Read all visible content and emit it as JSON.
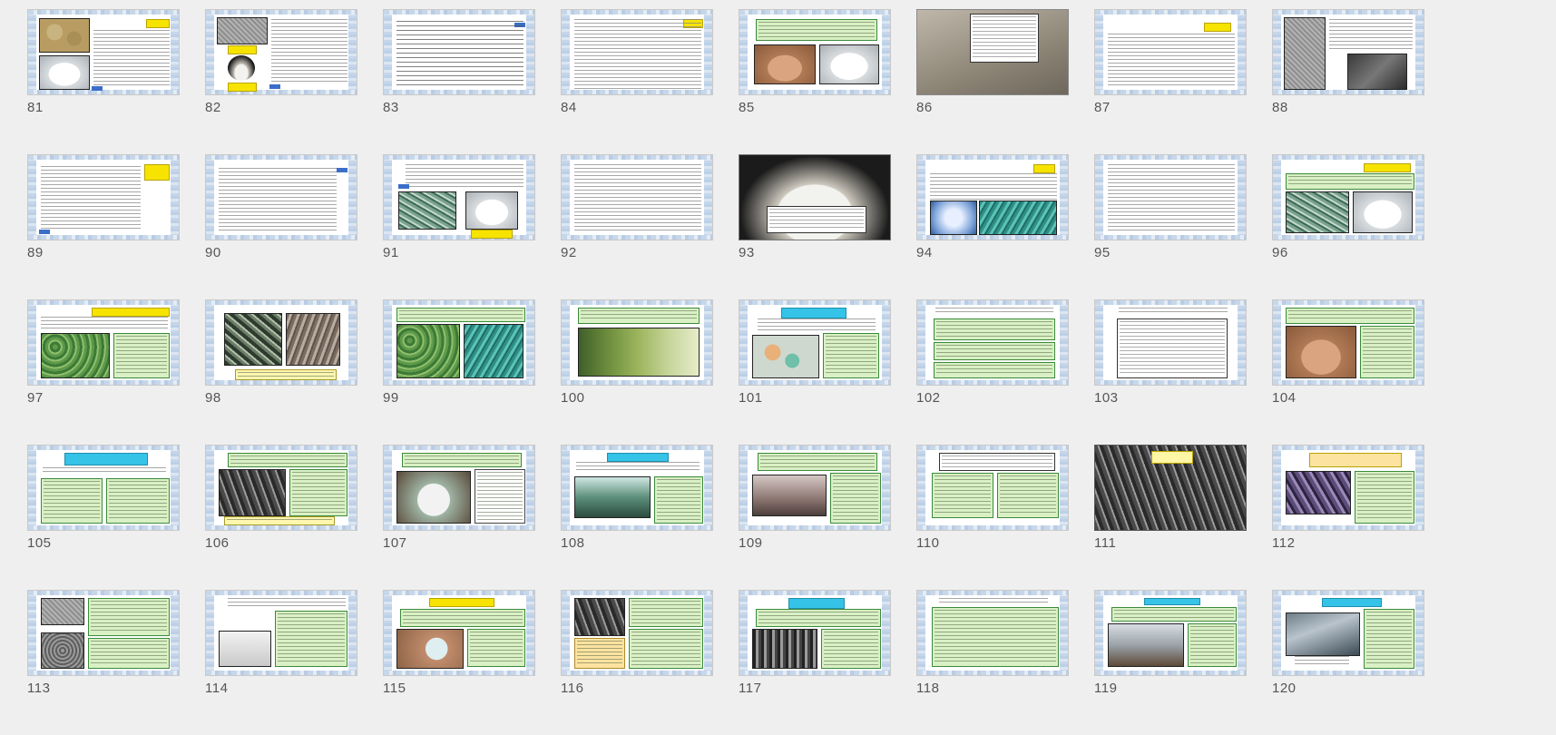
{
  "slides": [
    {
      "number": "81"
    },
    {
      "number": "82"
    },
    {
      "number": "83"
    },
    {
      "number": "84"
    },
    {
      "number": "85"
    },
    {
      "number": "86"
    },
    {
      "number": "87"
    },
    {
      "number": "88"
    },
    {
      "number": "89"
    },
    {
      "number": "90"
    },
    {
      "number": "91"
    },
    {
      "number": "92"
    },
    {
      "number": "93"
    },
    {
      "number": "94"
    },
    {
      "number": "95"
    },
    {
      "number": "96"
    },
    {
      "number": "97"
    },
    {
      "number": "98"
    },
    {
      "number": "99"
    },
    {
      "number": "100"
    },
    {
      "number": "101"
    },
    {
      "number": "102"
    },
    {
      "number": "103"
    },
    {
      "number": "104"
    },
    {
      "number": "105"
    },
    {
      "number": "106"
    },
    {
      "number": "107"
    },
    {
      "number": "108"
    },
    {
      "number": "109"
    },
    {
      "number": "110"
    },
    {
      "number": "111"
    },
    {
      "number": "112"
    },
    {
      "number": "113"
    },
    {
      "number": "114"
    },
    {
      "number": "115"
    },
    {
      "number": "116"
    },
    {
      "number": "117"
    },
    {
      "number": "118"
    },
    {
      "number": "119"
    },
    {
      "number": "120"
    }
  ],
  "icons": {
    "slide_thumbnail": "slide-thumbnail-icon",
    "nav_arrow": "blue-arrow-icon"
  },
  "colors": {
    "background": "#efefef",
    "accent_yellow": "#f6e300",
    "accent_cyan": "#35c3e8",
    "box_green": "#d9f0c4"
  }
}
